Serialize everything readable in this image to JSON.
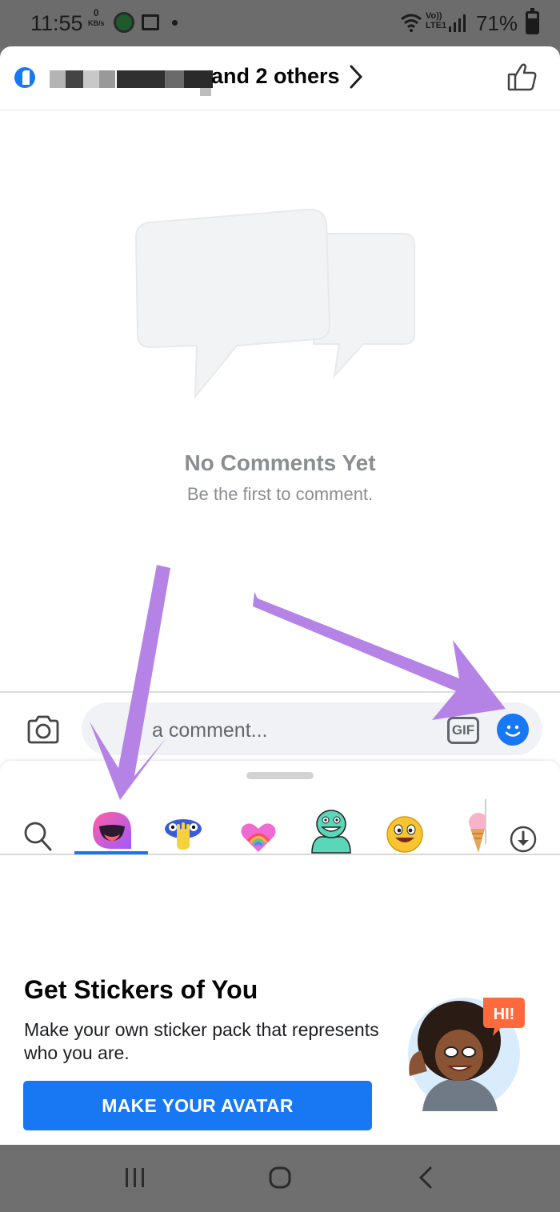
{
  "status_bar": {
    "time": "11:55",
    "net_speed": "0",
    "net_unit": "KB/s",
    "network": "Vo)) LTE1",
    "battery": "71%"
  },
  "header": {
    "others_text": "and 2 others"
  },
  "empty_state": {
    "title": "No Comments Yet",
    "subtitle": "Be the first to comment."
  },
  "composer": {
    "placeholder_visible": "a comment...",
    "gif_label": "GIF"
  },
  "stickers": {
    "tabs": [
      "search",
      "avatar",
      "hands",
      "rainbow-heart",
      "green-creature",
      "smiley",
      "ice-cream",
      "download"
    ],
    "active_tab": "avatar"
  },
  "promo": {
    "title": "Get Stickers of You",
    "description": "Make your own sticker pack that represents who you are.",
    "button_label": "MAKE YOUR AVATAR",
    "avatar_bubble": "HI!"
  },
  "colors": {
    "accent": "#1877f2",
    "annotation_arrow": "#b583e6"
  }
}
